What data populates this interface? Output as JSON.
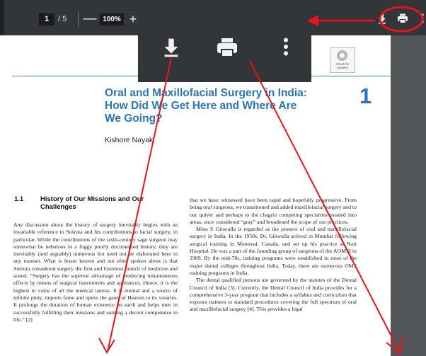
{
  "toolbar": {
    "page_current": "1",
    "page_separator": "/ 5",
    "zoom_minus": "—",
    "zoom_level": "100%",
    "zoom_plus": "+"
  },
  "badge": {
    "text": "Check for updates"
  },
  "chapter": {
    "title": "Oral and Maxillofacial Surgery in India: How Did We Get Here and Where Are We Going?",
    "number": "1",
    "author": "Kishore Nayak"
  },
  "section": {
    "number": "1.1",
    "title": "History of Our Missions and Our Challenges"
  },
  "col1": {
    "p1": "Any discussion about the history of surgery inevitably begins with an invariable reference to Suśruta and his contributions to facial surgery, in particular. While the contributions of the sixth-century sage surgeon may somewhat be nebulous in a foggy poorly documented history, they are inevitably (and arguably) numerous but need not be elaborated here in any manner. What is lesser known and not often spoken about is that Suśruta considered surgery the first and foremost branch of medicine and stated, “Surgery has the superior advantage of producing instantaneous effects by means of surgical instruments and appliances. Hence, it is the highest in value of all the medical tantras. It is eternal and a source of infinite piety, imports fame and opens the gates of Heaven to its votaries. It prolongs the duration of human existence on earth and helps men in successfully fulfilling their missions and earning a decent competence in life.” [2]"
  },
  "col2": {
    "p1": "that we have witnessed have been rapid and hopefully progressive. From being oral surgeons, we transitioned and added maxillofacial surgery and to our quiver and perhaps to the chagrin competing specialties treaded into areas, once considered “gray” and broadened the scope of our practices.",
    "p2": "Mino S Ginwalla is regarded as the pioneer of oral and maxillofacial surgery in India. In the 1950s, Dr. Ginwalla arrived in Mumbai following surgical training in Montreal, Canada, and set up his practice at Nair Hospital. He was a part of the founding group of surgeons of the AOMSI in 1969. By the mid-70s, training programs were established in most of the major dental colleges throughout India. Today, there are numerous OMS training programs in India.",
    "p3": "The dental qualified persons are governed by the statutes of the Dental Council of India [3]. Currently, the Dental Council of India provides for a comprehensive 3-year program that includes a syllabus and curriculum that exposes trainees to standard procedures covering the full spectrum of oral and maxillofacial surgery [4]. This provides a legal"
  },
  "icons": [
    "download-icon",
    "print-icon",
    "more-vert-icon"
  ],
  "colors": {
    "toolbar_bg": "#323639",
    "annotation_red": "#e8141b",
    "chapter_blue": "#2c74b5"
  }
}
